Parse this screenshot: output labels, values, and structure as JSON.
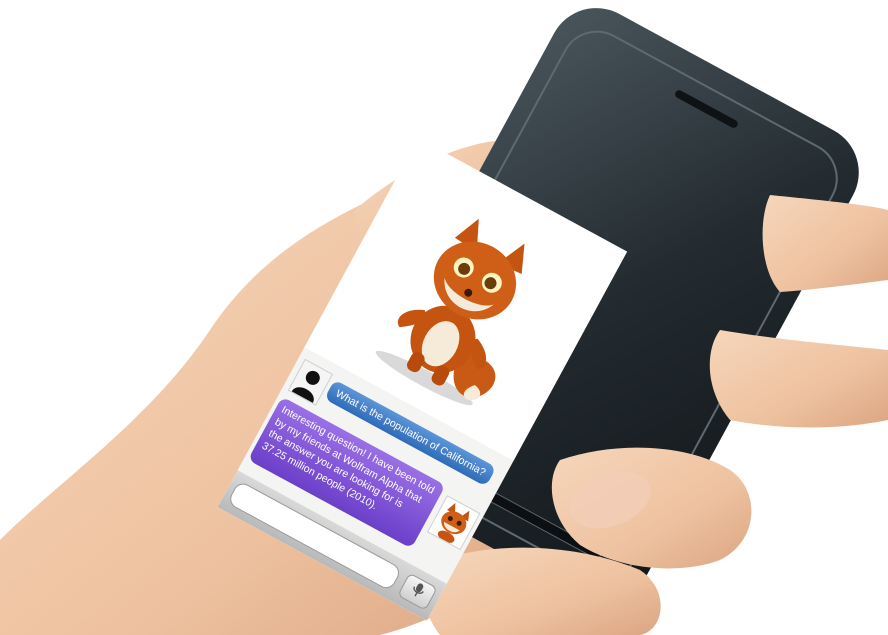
{
  "chat": {
    "user_message": "What is the population of California?",
    "bot_message": "Interesting question! I have been told by my friends at Wolfram Alpha that the answer you are looking for is 37.25 million people (2010)."
  },
  "input": {
    "value": "",
    "placeholder": ""
  },
  "icons": {
    "user_avatar": "user-silhouette-icon",
    "bot_avatar": "fox-icon",
    "mic": "microphone-icon"
  },
  "colors": {
    "user_bubble": "#3f7cc6",
    "bot_bubble": "#7a4fd6",
    "phone_body": "#2b3338",
    "skin": "#f0c9a8"
  }
}
